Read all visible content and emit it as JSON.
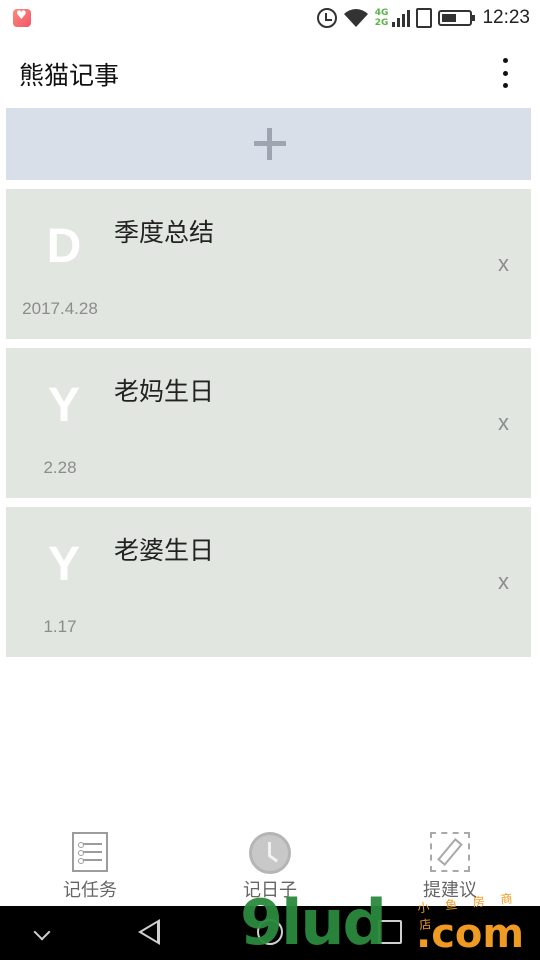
{
  "status_bar": {
    "time": "12:23",
    "network_top": "4G",
    "network_bottom": "2G",
    "icons": [
      "app-notification-icon",
      "alarm-icon",
      "wifi-icon",
      "signal-icon",
      "sim-icon",
      "battery-icon"
    ]
  },
  "app_bar": {
    "title": "熊猫记事",
    "menu_icon": "more-vert-icon"
  },
  "add_button": {
    "icon": "plus-icon"
  },
  "cards": [
    {
      "letter": "D",
      "title": "季度总结",
      "date": "2017.4.28",
      "delete_label": "x"
    },
    {
      "letter": "Y",
      "title": "老妈生日",
      "date": "2.28",
      "delete_label": "x"
    },
    {
      "letter": "Y",
      "title": "老婆生日",
      "date": "1.17",
      "delete_label": "x"
    }
  ],
  "bottom_nav": {
    "items": [
      {
        "label": "记任务",
        "icon": "task-list-icon"
      },
      {
        "label": "记日子",
        "icon": "clock-icon"
      },
      {
        "label": "提建议",
        "icon": "edit-suggest-icon"
      }
    ]
  },
  "system_nav": {
    "icons": [
      "chevron-down-icon",
      "back-icon",
      "home-icon",
      "recents-icon"
    ]
  },
  "watermark": {
    "main": "9lud",
    "com": ".com",
    "sub": "小 鱼 房 商 店"
  },
  "colors": {
    "add_bar": "#d9dfe9",
    "card": "#e2e6e0",
    "plus": "#a0a3b0"
  }
}
